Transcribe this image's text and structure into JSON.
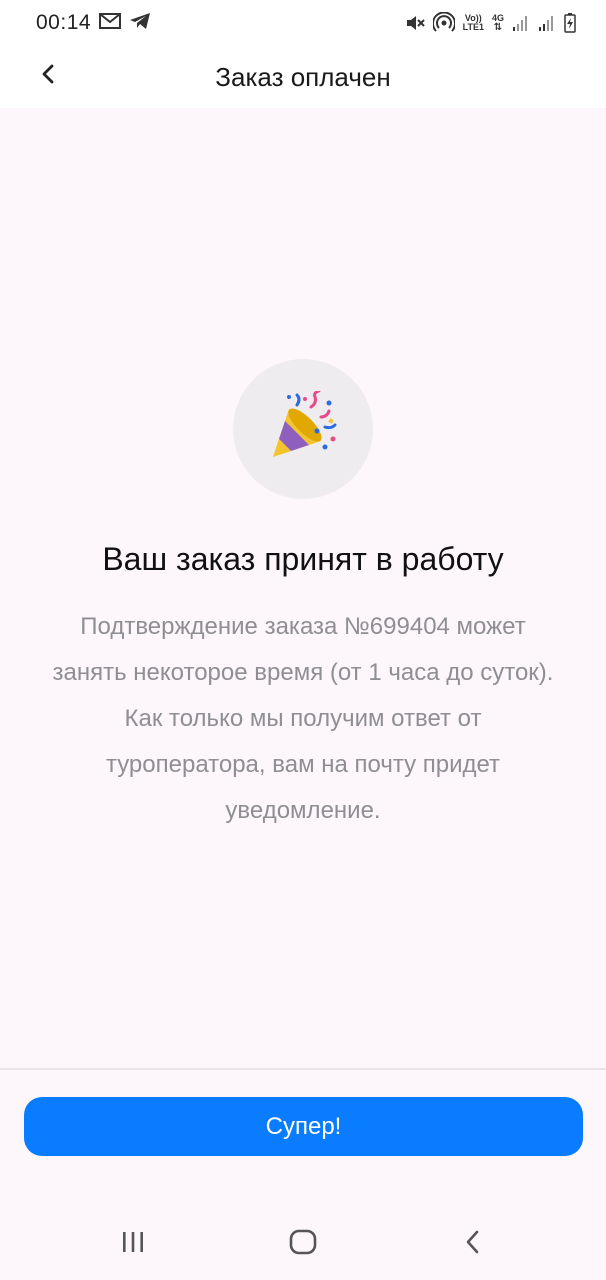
{
  "status_bar": {
    "time": "00:14",
    "net_top": "Vo))",
    "net_bottom": "LTE1",
    "gen_top": "4G"
  },
  "header": {
    "title": "Заказ оплачен"
  },
  "main": {
    "emoji": "party-popper-icon",
    "headline": "Ваш заказ принят в работу",
    "description": "Подтверждение заказа №699404 может занять некоторое время (от 1 часа до суток). Как только мы получим ответ от туроператора, вам на почту придет уведомление."
  },
  "footer": {
    "button_label": "Супер!"
  },
  "colors": {
    "accent": "#0a7cff",
    "background": "#fdf7fb",
    "muted_text": "#8e8e93"
  }
}
